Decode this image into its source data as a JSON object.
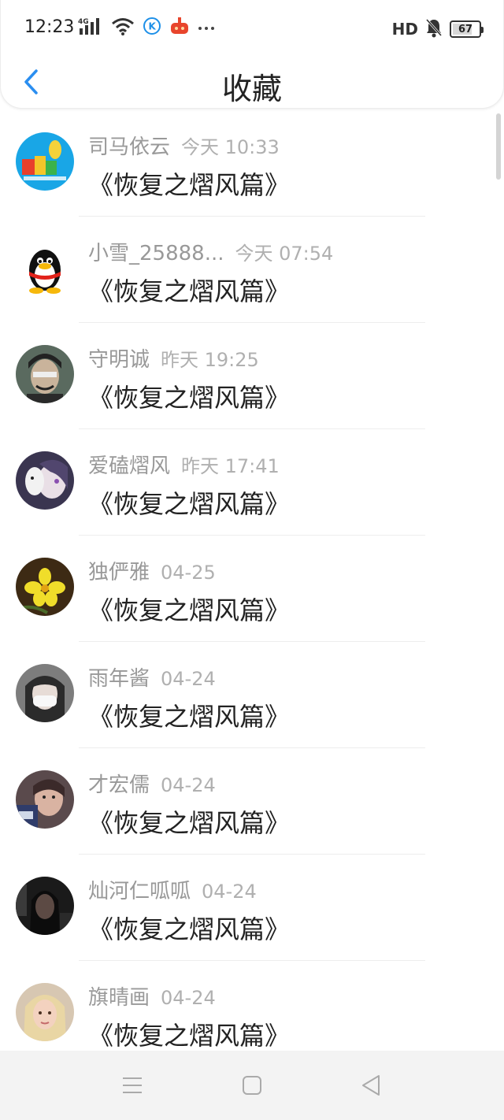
{
  "status_bar": {
    "time": "12:23",
    "network": "4G",
    "hd_label": "HD",
    "battery_level": "67",
    "battery_percent": 67,
    "icons": [
      "signal-4g-icon",
      "wifi-icon",
      "k-app-icon",
      "red-app-icon",
      "more-dots-icon",
      "mute-bell-icon",
      "battery-icon"
    ]
  },
  "header": {
    "title": "收藏",
    "back_icon": "chevron-left-icon",
    "accent_color": "#2a8ef0"
  },
  "favorites": [
    {
      "name": "司马依云",
      "time": "今天 10:33",
      "content": "《恢复之熠风篇》"
    },
    {
      "name": "小雪_25888...",
      "time": "今天 07:54",
      "content": "《恢复之熠风篇》"
    },
    {
      "name": "守明诚",
      "time": "昨天 19:25",
      "content": "《恢复之熠风篇》"
    },
    {
      "name": "爱磕熠风",
      "time": "昨天 17:41",
      "content": "《恢复之熠风篇》"
    },
    {
      "name": "独俨雅",
      "time": "04-25",
      "content": "《恢复之熠风篇》"
    },
    {
      "name": "雨年酱",
      "time": "04-24",
      "content": "《恢复之熠风篇》"
    },
    {
      "name": "才宏儒",
      "time": "04-24",
      "content": "《恢复之熠风篇》"
    },
    {
      "name": "灿河仁呱呱",
      "time": "04-24",
      "content": "《恢复之熠风篇》"
    },
    {
      "name": "旗晴画",
      "time": "04-24",
      "content": "《恢复之熠风篇》"
    }
  ],
  "nav_bar": {
    "icons": [
      "menu-icon",
      "home-square-icon",
      "back-triangle-icon"
    ]
  }
}
